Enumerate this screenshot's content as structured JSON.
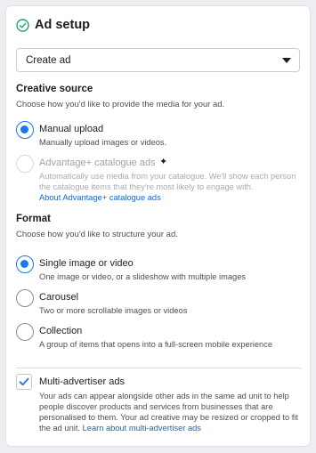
{
  "header": {
    "title": "Ad setup",
    "status_icon": "check-circle-icon"
  },
  "objective_select": {
    "value": "Create ad",
    "icon": "caret-down-icon"
  },
  "creative_source": {
    "title": "Creative source",
    "description": "Choose how you'd like to provide the media for your ad.",
    "options": [
      {
        "label": "Manual upload",
        "description": "Manually upload images or videos.",
        "selected": true,
        "disabled": false
      },
      {
        "label": "Advantage+ catalogue ads",
        "description": "Automatically use media from your catalogue. We'll show each person the catalogue items that they're most likely to engage with.",
        "link": "About Advantage+ catalogue ads",
        "selected": false,
        "disabled": true,
        "icon": "sparkle-icon"
      }
    ]
  },
  "format": {
    "title": "Format",
    "description": "Choose how you'd like to structure your ad.",
    "options": [
      {
        "label": "Single image or video",
        "description": "One image or video, or a slideshow with multiple images",
        "selected": true
      },
      {
        "label": "Carousel",
        "description": "Two or more scrollable images or videos",
        "selected": false
      },
      {
        "label": "Collection",
        "description": "A group of items that opens into a full-screen mobile experience",
        "selected": false
      }
    ]
  },
  "multi_advertiser": {
    "label": "Multi-advertiser ads",
    "checked": true,
    "description": "Your ads can appear alongside other ads in the same ad unit to help people discover products and services from businesses that are personalised to them. Your ad creative may be resized or cropped to fit the ad unit.",
    "link": "Learn about multi-advertiser ads"
  },
  "colors": {
    "accent": "#1877f2",
    "link": "#1467c9",
    "check": "#23a26d"
  }
}
